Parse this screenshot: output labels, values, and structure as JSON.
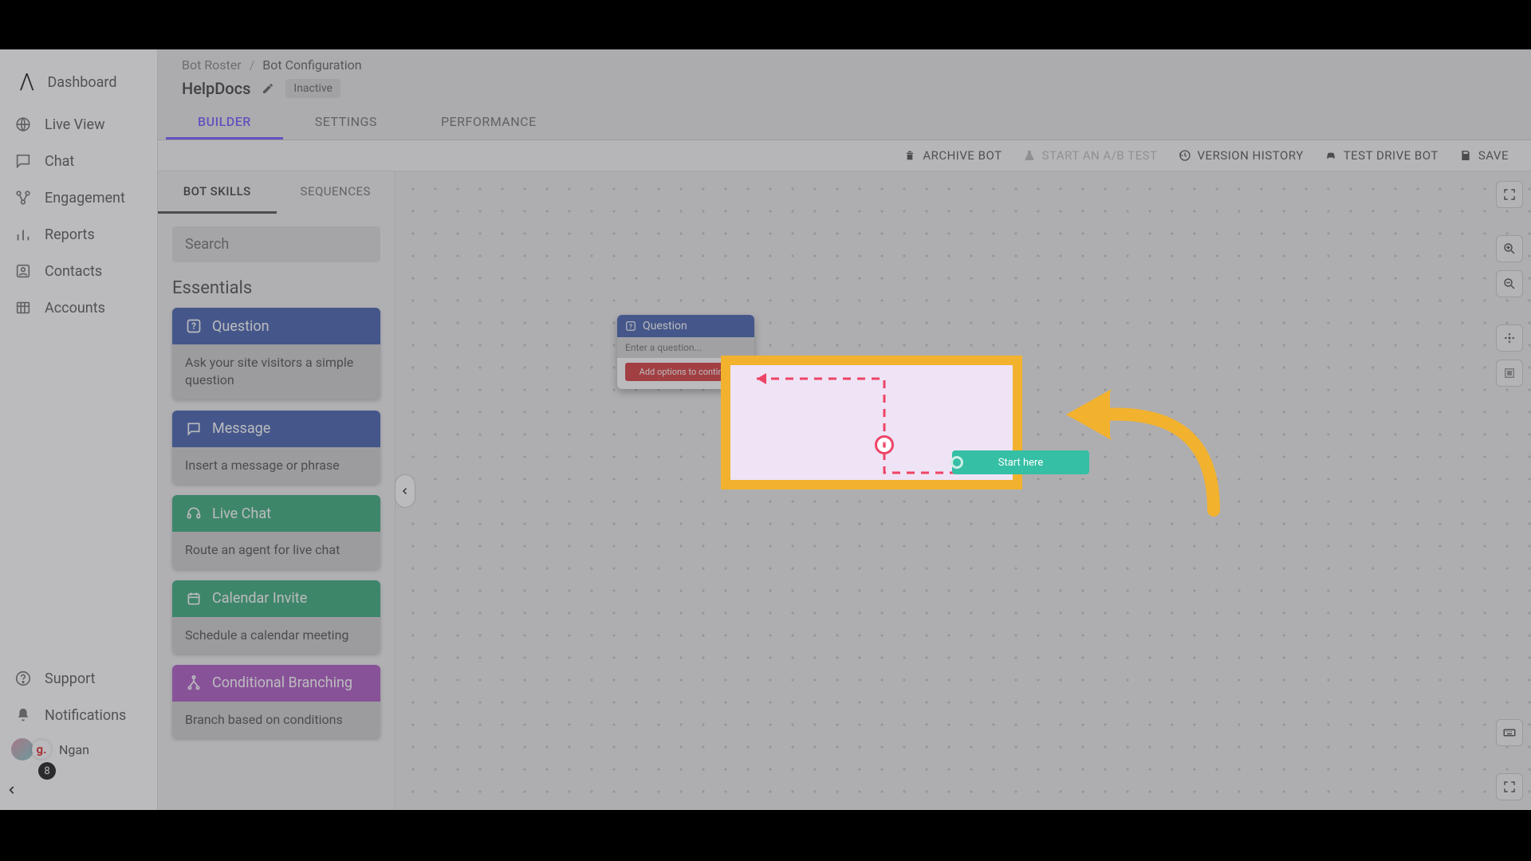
{
  "sidebar": {
    "items": [
      {
        "label": "Dashboard"
      },
      {
        "label": "Live View"
      },
      {
        "label": "Chat"
      },
      {
        "label": "Engagement"
      },
      {
        "label": "Reports"
      },
      {
        "label": "Contacts"
      },
      {
        "label": "Accounts"
      }
    ],
    "footer": [
      {
        "label": "Support"
      },
      {
        "label": "Notifications"
      }
    ],
    "user": {
      "name": "Ngan",
      "badge_letter": "g.",
      "count": "8"
    }
  },
  "breadcrumb": {
    "root": "Bot Roster",
    "current": "Bot Configuration"
  },
  "bot": {
    "name": "HelpDocs",
    "status": "Inactive"
  },
  "top_tabs": [
    {
      "label": "BUILDER",
      "active": true
    },
    {
      "label": "SETTINGS"
    },
    {
      "label": "PERFORMANCE"
    }
  ],
  "toolbar": {
    "archive": "ARCHIVE BOT",
    "abtest": "START AN A/B TEST",
    "history": "VERSION HISTORY",
    "testdrive": "TEST DRIVE BOT",
    "save": "SAVE"
  },
  "skills": {
    "tabs": [
      {
        "label": "BOT SKILLS",
        "active": true
      },
      {
        "label": "SEQUENCES"
      }
    ],
    "search_placeholder": "Search",
    "section_title": "Essentials",
    "cards": [
      {
        "title": "Question",
        "desc": "Ask your site visitors a simple question",
        "color": "blue",
        "icon": "question"
      },
      {
        "title": "Message",
        "desc": "Insert a message or phrase",
        "color": "blue",
        "icon": "message"
      },
      {
        "title": "Live Chat",
        "desc": "Route an agent for live chat",
        "color": "green",
        "icon": "headset"
      },
      {
        "title": "Calendar Invite",
        "desc": "Schedule a calendar meeting",
        "color": "green",
        "icon": "calendar"
      },
      {
        "title": "Conditional Branching",
        "desc": "Branch based on conditions",
        "color": "purple",
        "icon": "branch"
      }
    ]
  },
  "canvas": {
    "node": {
      "title": "Question",
      "placeholder": "Enter a question...",
      "option_prompt": "Add options to continue"
    },
    "start_label": "Start here"
  }
}
